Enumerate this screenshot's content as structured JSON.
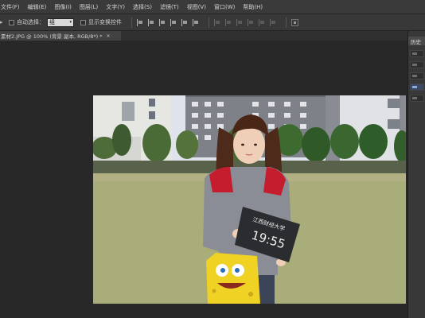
{
  "menu": [
    "文件(F)",
    "编辑(E)",
    "图像(I)",
    "图层(L)",
    "文字(Y)",
    "选择(S)",
    "滤镜(T)",
    "视图(V)",
    "窗口(W)",
    "帮助(H)"
  ],
  "options": {
    "auto_select_label": "自动选择：",
    "auto_select_value": "组",
    "show_transform_label": "显示变换控件"
  },
  "document": {
    "tab_label": "素材2.JPG @ 100% (背景 副本, RGB/8*) *",
    "close_glyph": "×"
  },
  "panel": {
    "history_label": "历史"
  },
  "photo": {
    "board_lines": [
      "江西财经大学",
      "19:55"
    ]
  },
  "colors": {
    "menubar": "#3a3a3a",
    "canvas_bg": "#282828",
    "sky": "#dfe4ec",
    "grass": "#a9ad79",
    "jacket_red": "#c41e2e",
    "hoodie_grey": "#8a8d96",
    "bag_yellow": "#f0d224"
  }
}
